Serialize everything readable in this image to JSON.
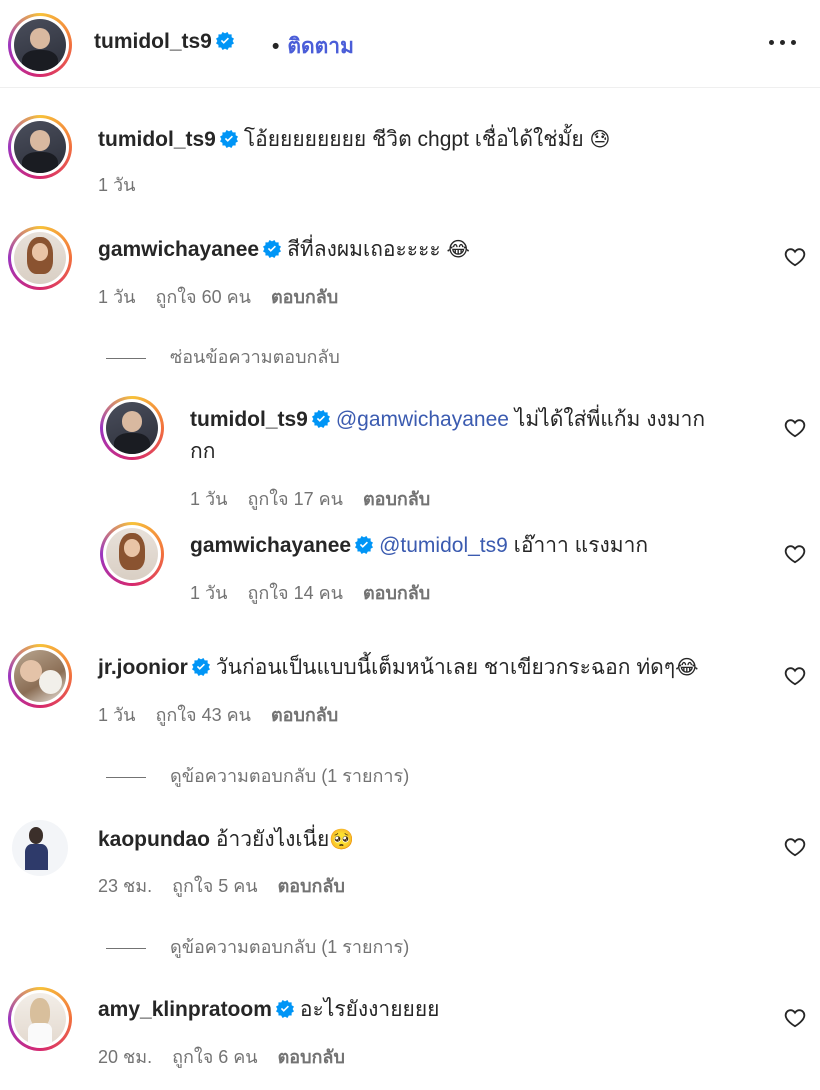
{
  "header": {
    "username": "tumidol_ts9",
    "dot": "•",
    "follow_label": "ติดตาม"
  },
  "comments": [
    {
      "username": "tumidol_ts9",
      "text": "โอ้ยยยยยยยย ชีวิต chgpt เชื่อได้ใช่มั้ย",
      "emoji": "😓",
      "time": "1 วัน"
    },
    {
      "username": "gamwichayanee",
      "text": "สีที่ลงผมเถอะะะะ",
      "emoji": "😂",
      "time": "1 วัน",
      "likes": "ถูกใจ 60 คน",
      "reply_label": "ตอบกลับ",
      "thread_toggle": "ซ่อนข้อความตอบกลับ",
      "replies": [
        {
          "username": "tumidol_ts9",
          "mention": "@gamwichayanee",
          "text_line1": "ไม่ได้ใส่พี่แก้ม งงมาก",
          "text_line2": "กก",
          "time": "1 วัน",
          "likes": "ถูกใจ 17 คน",
          "reply_label": "ตอบกลับ"
        },
        {
          "username": "gamwichayanee",
          "mention": "@tumidol_ts9",
          "text": "เอ๊าาา แรงมาก",
          "time": "1 วัน",
          "likes": "ถูกใจ 14 คน",
          "reply_label": "ตอบกลับ"
        }
      ]
    },
    {
      "username": "jr.joonior",
      "text": "วันก่อนเป็นแบบนี้เต็มหน้าเลย ชาเขียวกระฉอก ท่ดๆ",
      "emoji": "😂",
      "time": "1 วัน",
      "likes": "ถูกใจ 43 คน",
      "reply_label": "ตอบกลับ",
      "thread_toggle": "ดูข้อความตอบกลับ (1 รายการ)"
    },
    {
      "username": "kaopundao",
      "text": "อ้าวยังไงเนี่ย",
      "emoji": "🥺",
      "time": "23 ชม.",
      "likes": "ถูกใจ 5 คน",
      "reply_label": "ตอบกลับ",
      "thread_toggle": "ดูข้อความตอบกลับ (1 รายการ)"
    },
    {
      "username": "amy_klinpratoom",
      "text": "อะไรยังงายยยย",
      "time": "20 ชม.",
      "likes": "ถูกใจ 6 คน",
      "reply_label": "ตอบกลับ"
    }
  ],
  "icons": {
    "verified": "verified-badge-icon",
    "heart": "heart-outline-icon",
    "more": "more-horizontal-icon"
  },
  "colors": {
    "verified": "#0095f6",
    "follow": "#4a5dd8",
    "mention": "#3b5bb0",
    "muted": "#737373"
  }
}
